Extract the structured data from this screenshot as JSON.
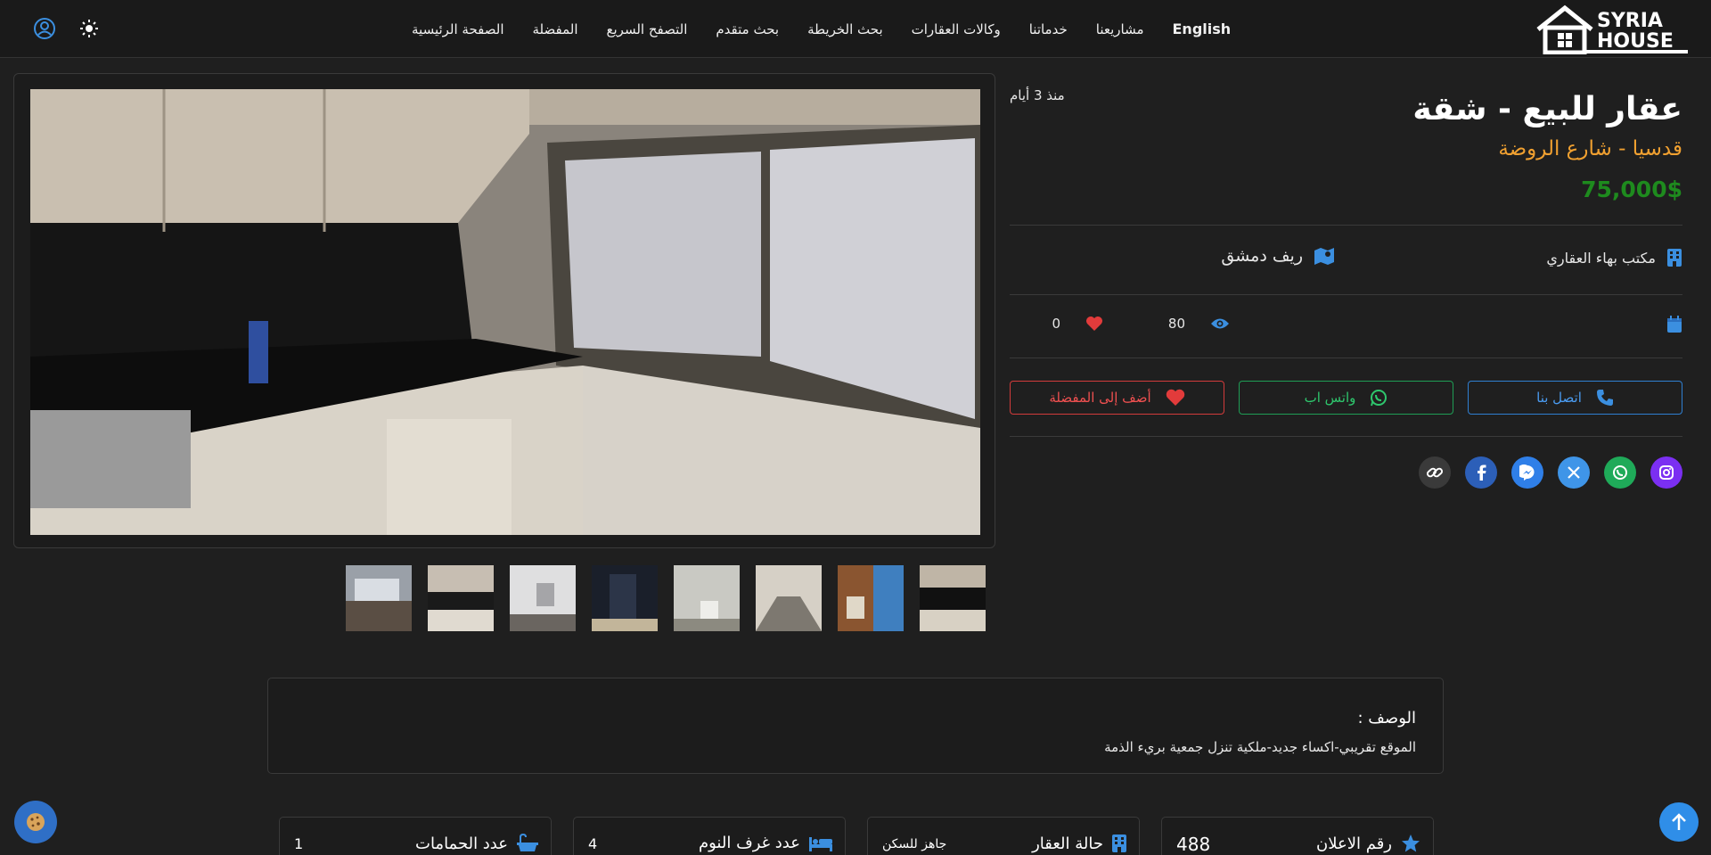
{
  "brand": {
    "logo_text_1": "SYRIA",
    "logo_text_2": "HOUSE"
  },
  "nav": {
    "items": [
      {
        "label": "الصفحة الرئيسية"
      },
      {
        "label": "المفضلة"
      },
      {
        "label": "التصفح السريع"
      },
      {
        "label": "بحث متقدم"
      },
      {
        "label": "بحث الخريطة"
      },
      {
        "label": "وكالات العقارات"
      },
      {
        "label": "خدماتنا"
      },
      {
        "label": "مشاريعنا"
      }
    ],
    "language": "English",
    "theme_icon": "sun-icon",
    "account_icon": "user-circle-icon"
  },
  "listing": {
    "title": "عقار للبيع - شقة",
    "location": "قدسيا - شارع الروضة",
    "price": "75,000$",
    "posted": "منذ 3 أيام",
    "office": "مكتب بهاء العقاري",
    "region": "ريف دمشق",
    "views": "80",
    "likes": "0"
  },
  "actions": {
    "call": "اتصل بنا",
    "whatsapp": "واتس اب",
    "favorite": "أضف إلى المفضلة"
  },
  "share": [
    "instagram-icon",
    "whatsapp-icon",
    "x-icon",
    "messenger-icon",
    "facebook-icon",
    "link-icon"
  ],
  "description": {
    "title": "الوصف :",
    "text": "الموقع تقريبي-اكساء جديد-ملكية تنزل جمعية بريء الذمة"
  },
  "features": [
    {
      "label": "رقم الاعلان",
      "value": "488",
      "icon": "star-icon"
    },
    {
      "label": "حالة العقار",
      "value": "جاهز للسكن",
      "icon": "building-icon"
    },
    {
      "label": "عدد غرف النوم",
      "value": "4",
      "icon": "bed-icon"
    },
    {
      "label": "عدد الحمامات",
      "value": "1",
      "icon": "bath-icon"
    }
  ],
  "colors": {
    "accent": "#2f8ee8",
    "location": "#f0a030",
    "price": "#1e8b1e",
    "whatsapp": "#1f9d55",
    "favorite": "#d23b3b"
  }
}
